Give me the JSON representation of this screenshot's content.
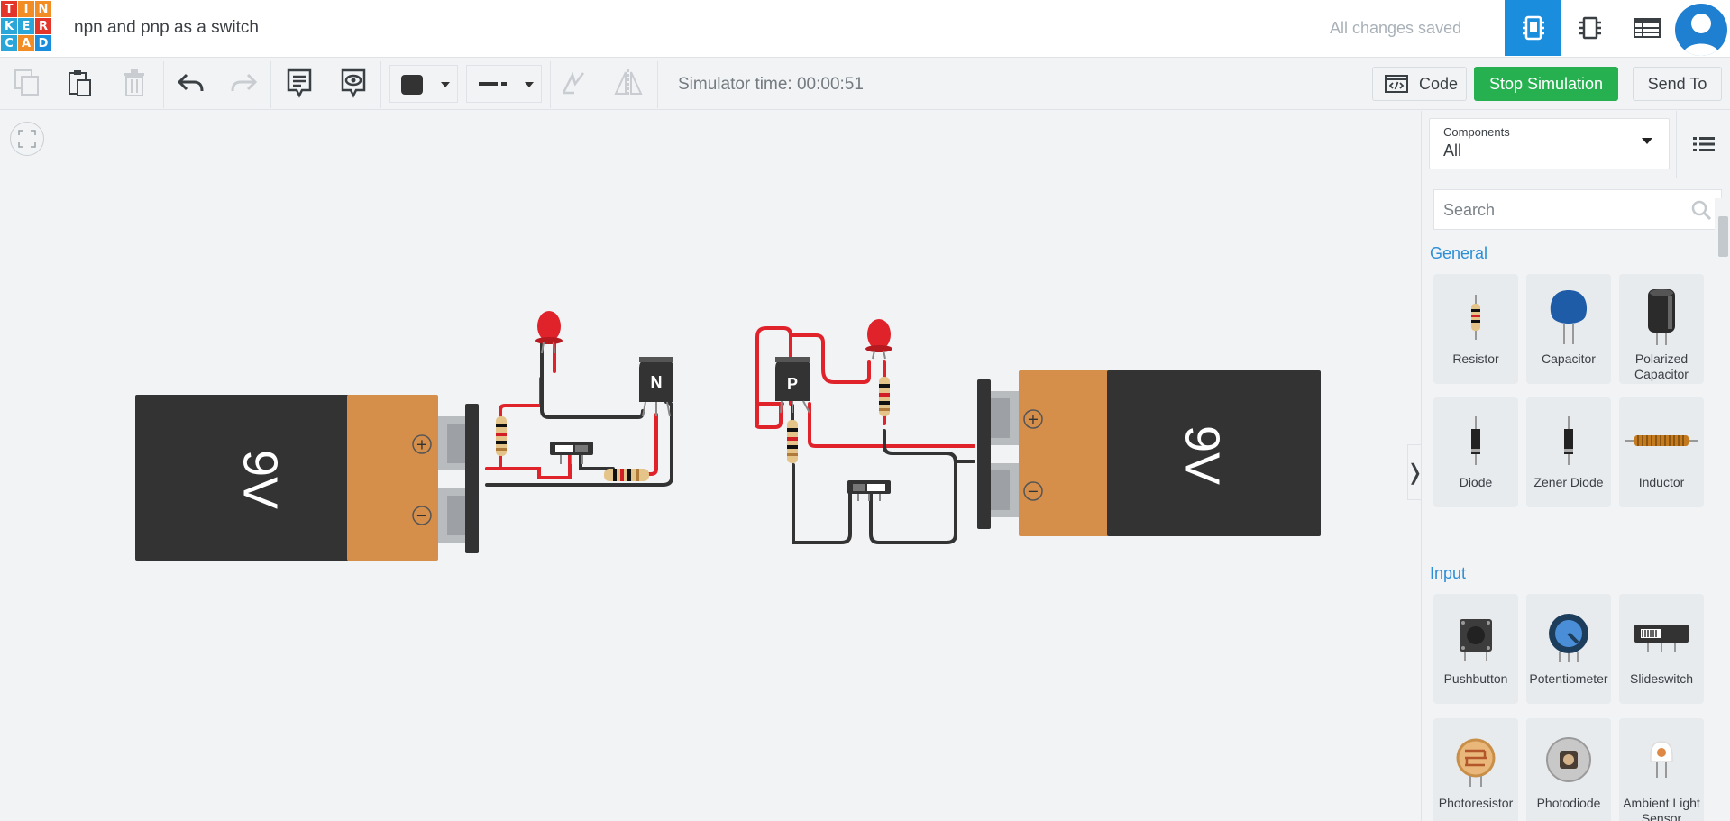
{
  "app": {
    "logo_letters": [
      "T",
      "I",
      "N",
      "K",
      "E",
      "R",
      "C",
      "A",
      "D"
    ],
    "logo_colors": [
      "#e4352b",
      "#f28c24",
      "#f28c24",
      "#2aa7d8",
      "#2aa7d8",
      "#e4352b",
      "#2aa7d8",
      "#f28c24",
      "#1b8ddd"
    ],
    "title": "npn and pnp as a switch",
    "status": "All changes saved"
  },
  "header": {
    "views": [
      {
        "name": "circuit-view",
        "icon": "circuit-board-icon",
        "active": true
      },
      {
        "name": "schematic-view",
        "icon": "chip-icon",
        "active": false
      },
      {
        "name": "component-list-view",
        "icon": "table-icon",
        "active": false
      }
    ]
  },
  "toolbar": {
    "simulator_time": "Simulator time: 00:00:51",
    "code_label": "Code",
    "stop_label": "Stop Simulation",
    "send_label": "Send To",
    "wire_color": "#333333"
  },
  "canvas": {
    "batteries": [
      {
        "label": "9V"
      },
      {
        "label": "9V"
      }
    ],
    "transistors": [
      {
        "label": "N"
      },
      {
        "label": "P"
      }
    ],
    "battery_plus": "+",
    "battery_minus": "−"
  },
  "panel": {
    "components_label": "Components",
    "components_value": "All",
    "search_placeholder": "Search",
    "sections": [
      {
        "title": "General",
        "items": [
          "Resistor",
          "Capacitor",
          "Polarized Capacitor",
          "Diode",
          "Zener Diode",
          "Inductor"
        ]
      },
      {
        "title": "Input",
        "items": [
          "Pushbutton",
          "Potentiometer",
          "Slideswitch",
          "Photoresistor",
          "Photodiode",
          "Ambient Light Sensor"
        ]
      }
    ]
  },
  "colors": {
    "accent": "#1b8ddd",
    "stop_green": "#26b050",
    "section_blue": "#2d8fd6",
    "wire_red": "#e0232b",
    "battery_orange": "#d58f4b",
    "battery_dark": "#333333"
  }
}
